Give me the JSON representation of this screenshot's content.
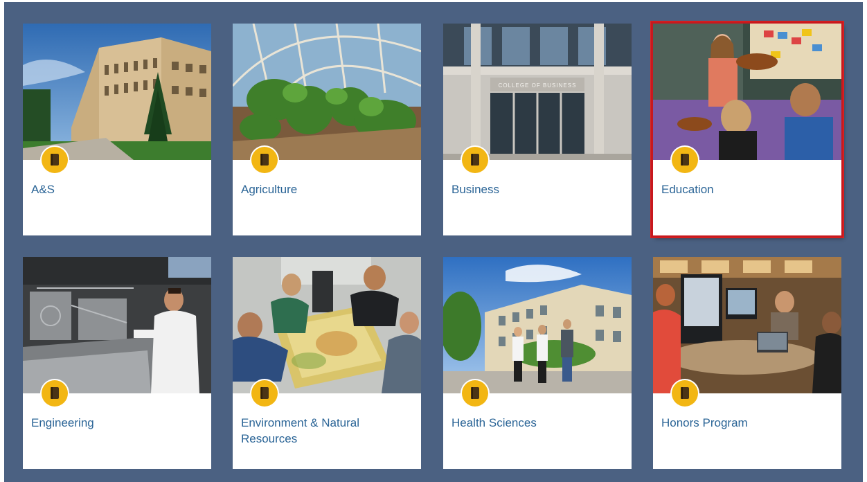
{
  "colleges": [
    {
      "label": "A&S",
      "icon": "book-icon",
      "photo": "campus-building-photo",
      "selected": false
    },
    {
      "label": "Agriculture",
      "icon": "book-icon",
      "photo": "greenhouse-photo",
      "selected": false
    },
    {
      "label": "Business",
      "icon": "book-icon",
      "photo": "college-of-business-entrance-photo",
      "building_sign": "COLLEGE OF BUSINESS",
      "selected": false
    },
    {
      "label": "Education",
      "icon": "book-icon",
      "photo": "violin-classroom-photo",
      "selected": true
    },
    {
      "label": "Engineering",
      "icon": "book-icon",
      "photo": "engineering-lab-photo",
      "selected": false
    },
    {
      "label": "Environment & Natural Resources",
      "icon": "book-icon",
      "photo": "sand-table-photo",
      "selected": false
    },
    {
      "label": "Health Sciences",
      "icon": "book-icon",
      "photo": "students-walking-photo",
      "selected": false
    },
    {
      "label": "Honors Program",
      "icon": "book-icon",
      "photo": "study-lounge-photo",
      "selected": false
    }
  ],
  "colors": {
    "background": "#4b6182",
    "card": "#ffffff",
    "label": "#2a6496",
    "badge": "#f2b613",
    "selection_border": "#c8181e"
  }
}
